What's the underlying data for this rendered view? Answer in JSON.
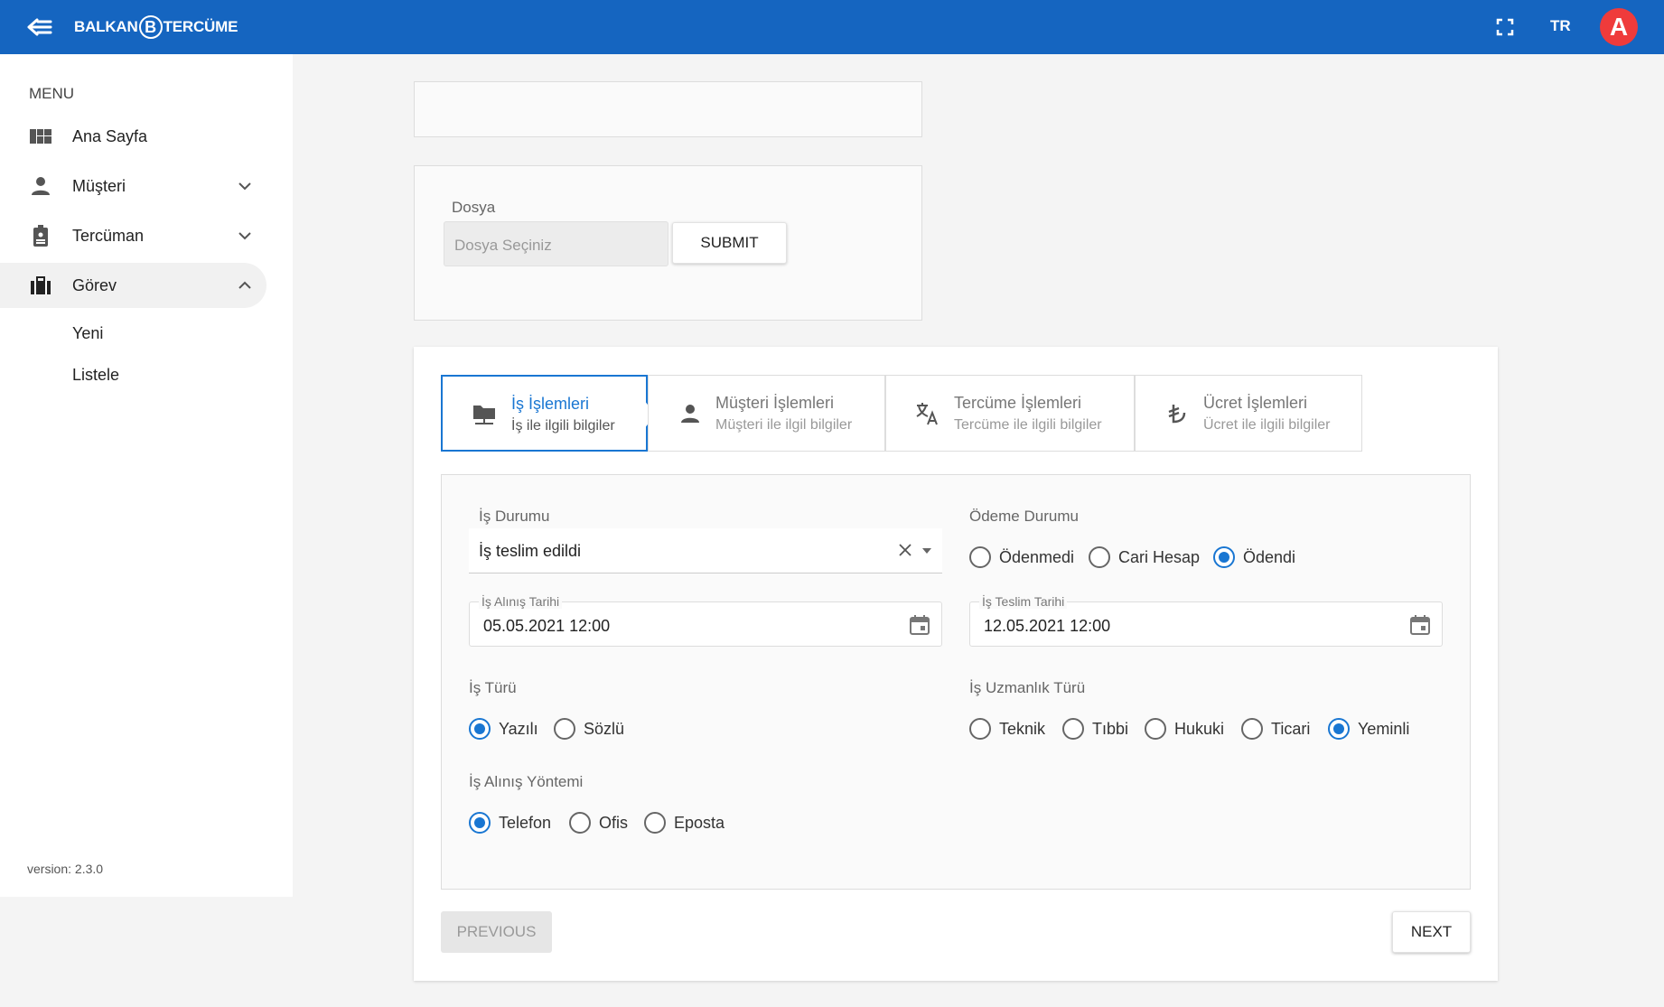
{
  "header": {
    "logo_left": "BALKAN",
    "logo_mid": "B",
    "logo_right": "TERCÜME",
    "language": "TR",
    "avatar_letter": "A",
    "colors": {
      "brand": "#1565c0",
      "avatar": "#ef3b3b"
    }
  },
  "sidebar": {
    "menu_title": "MENU",
    "items": [
      {
        "label": "Ana Sayfa",
        "icon": "dashboard-icon"
      },
      {
        "label": "Müşteri",
        "icon": "person-icon"
      },
      {
        "label": "Tercüman",
        "icon": "badge-icon"
      },
      {
        "label": "Görev",
        "icon": "briefcase-icon"
      }
    ],
    "sub_items": [
      "Yeni",
      "Listele"
    ],
    "version": "version: 2.3.0"
  },
  "upload": {
    "label": "Dosya",
    "placeholder": "Dosya Seçiniz",
    "submit_label": "SUBMIT"
  },
  "steps": [
    {
      "title": "İş İşlemleri",
      "subtitle": "İş ile ilgili bilgiler",
      "icon": "folder-network-icon"
    },
    {
      "title": "Müşteri İşlemleri",
      "subtitle": "Müşteri ile ilgil bilgiler",
      "icon": "person-icon"
    },
    {
      "title": "Tercüme İşlemleri",
      "subtitle": "Tercüme ile ilgili bilgiler",
      "icon": "translate-icon"
    },
    {
      "title": "Ücret İşlemleri",
      "subtitle": "Ücret ile ilgili bilgiler",
      "icon": "lira-icon"
    }
  ],
  "form": {
    "is_durumu": {
      "label": "İş Durumu",
      "value": "İş teslim edildi"
    },
    "odeme_durumu": {
      "label": "Ödeme Durumu",
      "options": [
        "Ödenmedi",
        "Cari Hesap",
        "Ödendi"
      ],
      "selected": "Ödendi"
    },
    "alinis_tarihi": {
      "label": "İş Alınış Tarihi",
      "value": "05.05.2021 12:00"
    },
    "teslim_tarihi": {
      "label": "İş Teslim Tarihi",
      "value": "12.05.2021 12:00"
    },
    "is_turu": {
      "label": "İş Türü",
      "options": [
        "Yazılı",
        "Sözlü"
      ],
      "selected": "Yazılı"
    },
    "uzmanlik_turu": {
      "label": "İş Uzmanlık Türü",
      "options": [
        "Teknik",
        "Tıbbi",
        "Hukuki",
        "Ticari",
        "Yeminli"
      ],
      "selected": "Yeminli"
    },
    "alinis_yontemi": {
      "label": "İş Alınış Yöntemi",
      "options": [
        "Telefon",
        "Ofis",
        "Eposta"
      ],
      "selected": "Telefon"
    }
  },
  "nav_buttons": {
    "previous": "PREVIOUS",
    "next": "NEXT"
  }
}
